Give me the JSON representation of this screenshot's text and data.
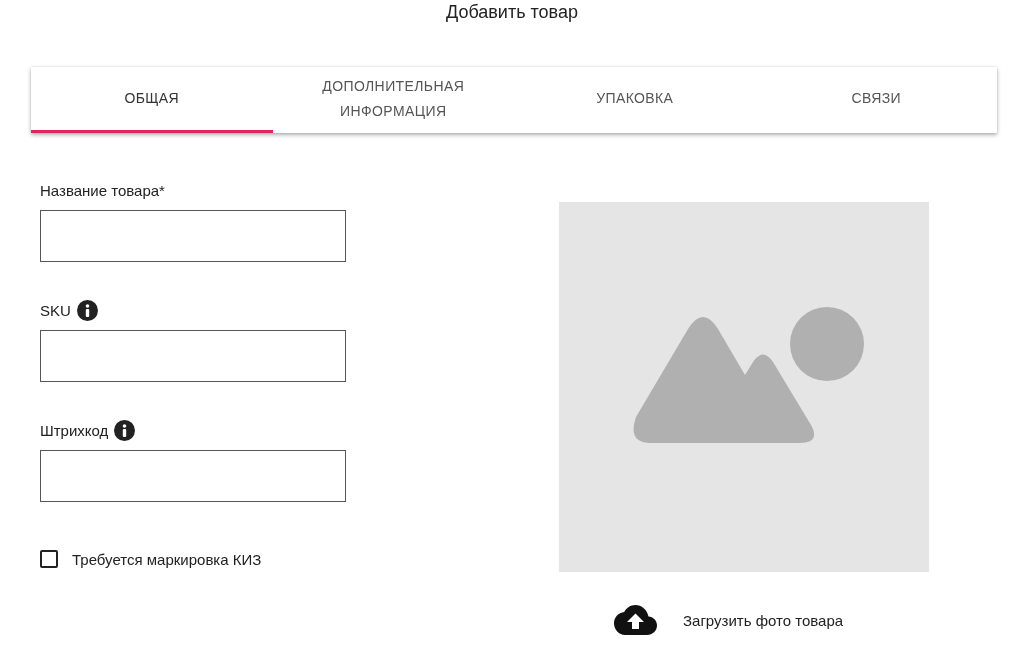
{
  "title": "Добавить товар",
  "tabs": [
    {
      "label": "ОБЩАЯ",
      "selected": true
    },
    {
      "label": "ДОПОЛНИТЕЛЬНАЯ ИНФОРМАЦИЯ",
      "selected": false
    },
    {
      "label": "УПАКОВКА",
      "selected": false
    },
    {
      "label": "СВЯЗИ",
      "selected": false
    }
  ],
  "fields": [
    {
      "label": "Название товара*",
      "info": false
    },
    {
      "label": "SKU",
      "info": true
    },
    {
      "label": "Штрихкод",
      "info": true
    }
  ],
  "checkbox": {
    "label": "Требуется маркировка КИЗ",
    "checked": false
  },
  "upload": {
    "label": "Загрузить фото товара"
  }
}
